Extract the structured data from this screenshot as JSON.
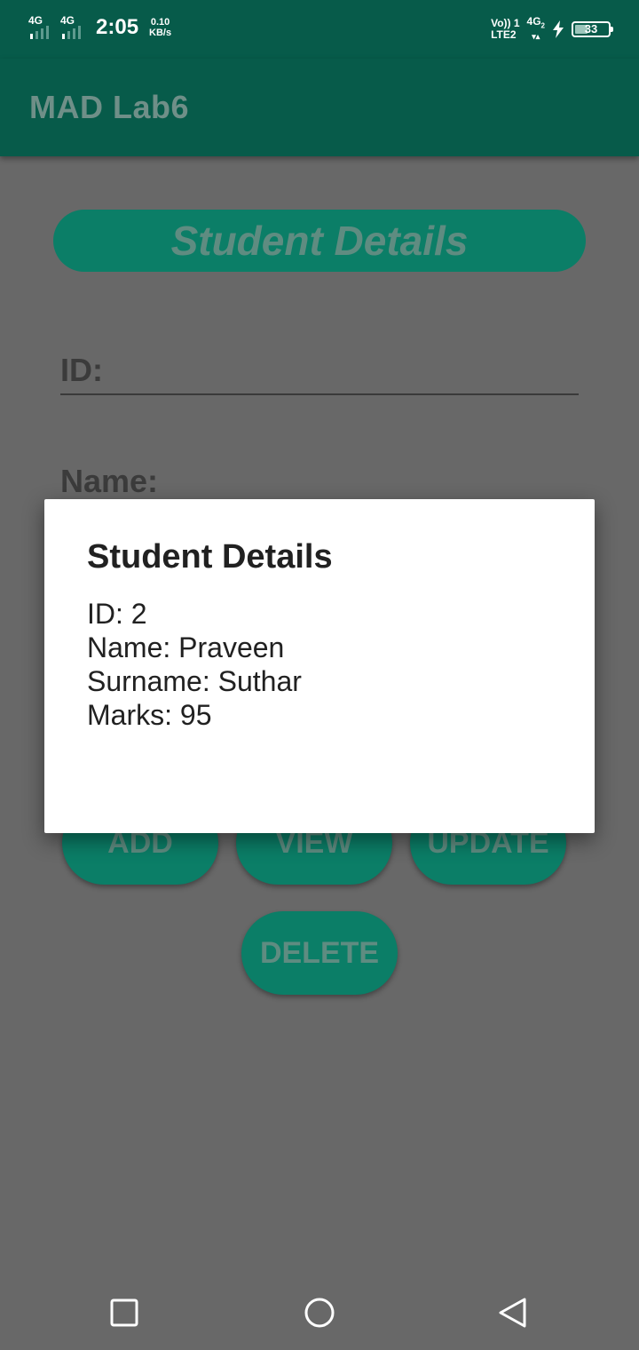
{
  "status_bar": {
    "sim1_type": "4G",
    "sim2_type": "4G",
    "time": "2:05",
    "speed_value": "0.10",
    "speed_unit": "KB/s",
    "volte_top": "Vo)) 1",
    "volte_bottom": "LTE2",
    "net_type": "4G",
    "net_sub": "2",
    "battery_level": "33"
  },
  "app_bar": {
    "title": "MAD Lab6"
  },
  "form": {
    "heading": "Student Details",
    "id_label": "ID:",
    "name_label": "Name:"
  },
  "buttons": {
    "add": "ADD",
    "view": "VIEW",
    "update": "UPDATE",
    "delete": "DELETE"
  },
  "dialog": {
    "title": "Student Details",
    "lines": [
      "ID: 2",
      "Name: Praveen",
      "Surname: Suthar",
      "Marks: 95"
    ]
  },
  "nav": {
    "recents_icon": "square-icon",
    "home_icon": "circle-icon",
    "back_icon": "triangle-back-icon"
  }
}
